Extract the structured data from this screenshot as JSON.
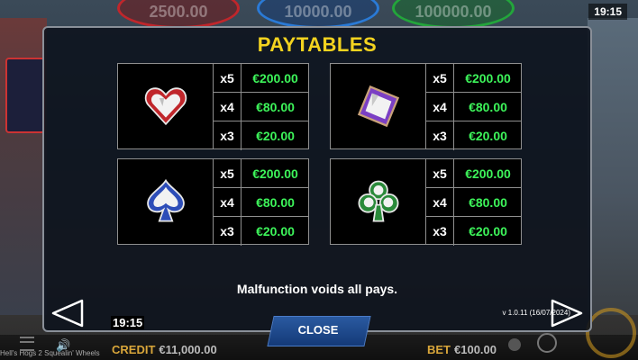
{
  "background": {
    "jackpots": [
      "2500.00",
      "10000.00",
      "100000.00"
    ],
    "clock": "19:15"
  },
  "modal": {
    "title": "PAYTABLES",
    "symbols": [
      {
        "symbol": "heart-icon",
        "color": "#c0262b",
        "rows": [
          {
            "mult": "x5",
            "pay": "€200.00"
          },
          {
            "mult": "x4",
            "pay": "€80.00"
          },
          {
            "mult": "x3",
            "pay": "€20.00"
          }
        ]
      },
      {
        "symbol": "diamond-icon",
        "color": "#7b3fc4",
        "rows": [
          {
            "mult": "x5",
            "pay": "€200.00"
          },
          {
            "mult": "x4",
            "pay": "€80.00"
          },
          {
            "mult": "x3",
            "pay": "€20.00"
          }
        ]
      },
      {
        "symbol": "spade-icon",
        "color": "#2d4db8",
        "rows": [
          {
            "mult": "x5",
            "pay": "€200.00"
          },
          {
            "mult": "x4",
            "pay": "€80.00"
          },
          {
            "mult": "x3",
            "pay": "€20.00"
          }
        ]
      },
      {
        "symbol": "club-icon",
        "color": "#2a8a3a",
        "rows": [
          {
            "mult": "x5",
            "pay": "€200.00"
          },
          {
            "mult": "x4",
            "pay": "€80.00"
          },
          {
            "mult": "x3",
            "pay": "€20.00"
          }
        ]
      }
    ],
    "notice": "Malfunction voids all pays.",
    "version": "v 1.0.11 (16/07/2024)",
    "clock": "19:15",
    "close_label": "CLOSE"
  },
  "bottom_bar": {
    "game_name": "Hell's Hogs 2 Squealin' Wheels",
    "credit_label": "CREDIT",
    "credit_value": "€11,000.00",
    "bet_label": "BET",
    "bet_value": "€100.00"
  },
  "colors": {
    "title": "#f4d31f",
    "payout": "#3df45a",
    "label_gold": "#d9a63a"
  }
}
